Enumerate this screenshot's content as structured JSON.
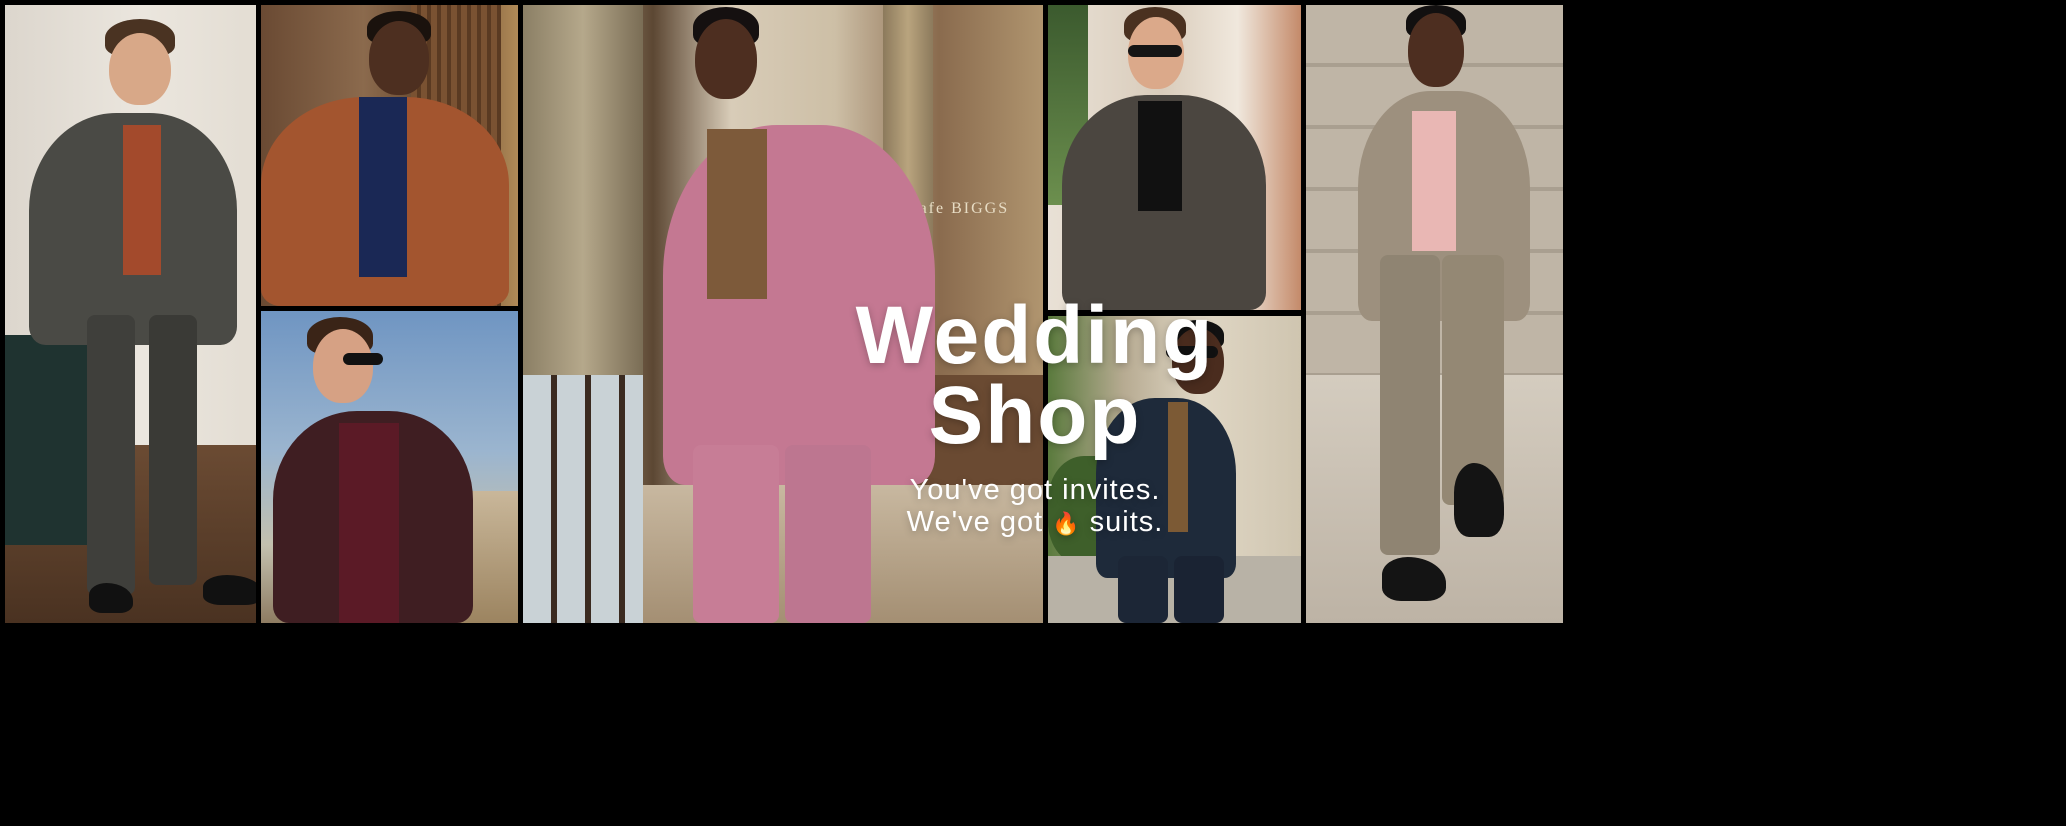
{
  "promo": {
    "title_line1": "Wedding",
    "title_line2": "Shop",
    "subtitle_line1": "You've got invites.",
    "subtitle_line2_prefix": "We've got ",
    "subtitle_line2_emoji": "🔥",
    "subtitle_line2_suffix": " suits.",
    "sign_text": "Cafe BIGGS"
  },
  "photos": [
    {
      "id": "grey-check-suit",
      "description": "Man in charcoal check suit with rust sweater"
    },
    {
      "id": "rust-blazer",
      "description": "Man in rust blazer with navy shirt"
    },
    {
      "id": "burgundy-blazer",
      "description": "Man in burgundy blazer with sunglasses"
    },
    {
      "id": "pink-suit",
      "description": "Man in pink suit"
    },
    {
      "id": "charcoal-blazer",
      "description": "Man in charcoal blazer with sunglasses"
    },
    {
      "id": "navy-suit",
      "description": "Man in navy suit with patterned shirt"
    },
    {
      "id": "plaid-suit",
      "description": "Man in light plaid suit with pink tee"
    }
  ],
  "colors": {
    "background": "#000000",
    "pink_suit": "#c47892",
    "text": "#ffffff"
  }
}
